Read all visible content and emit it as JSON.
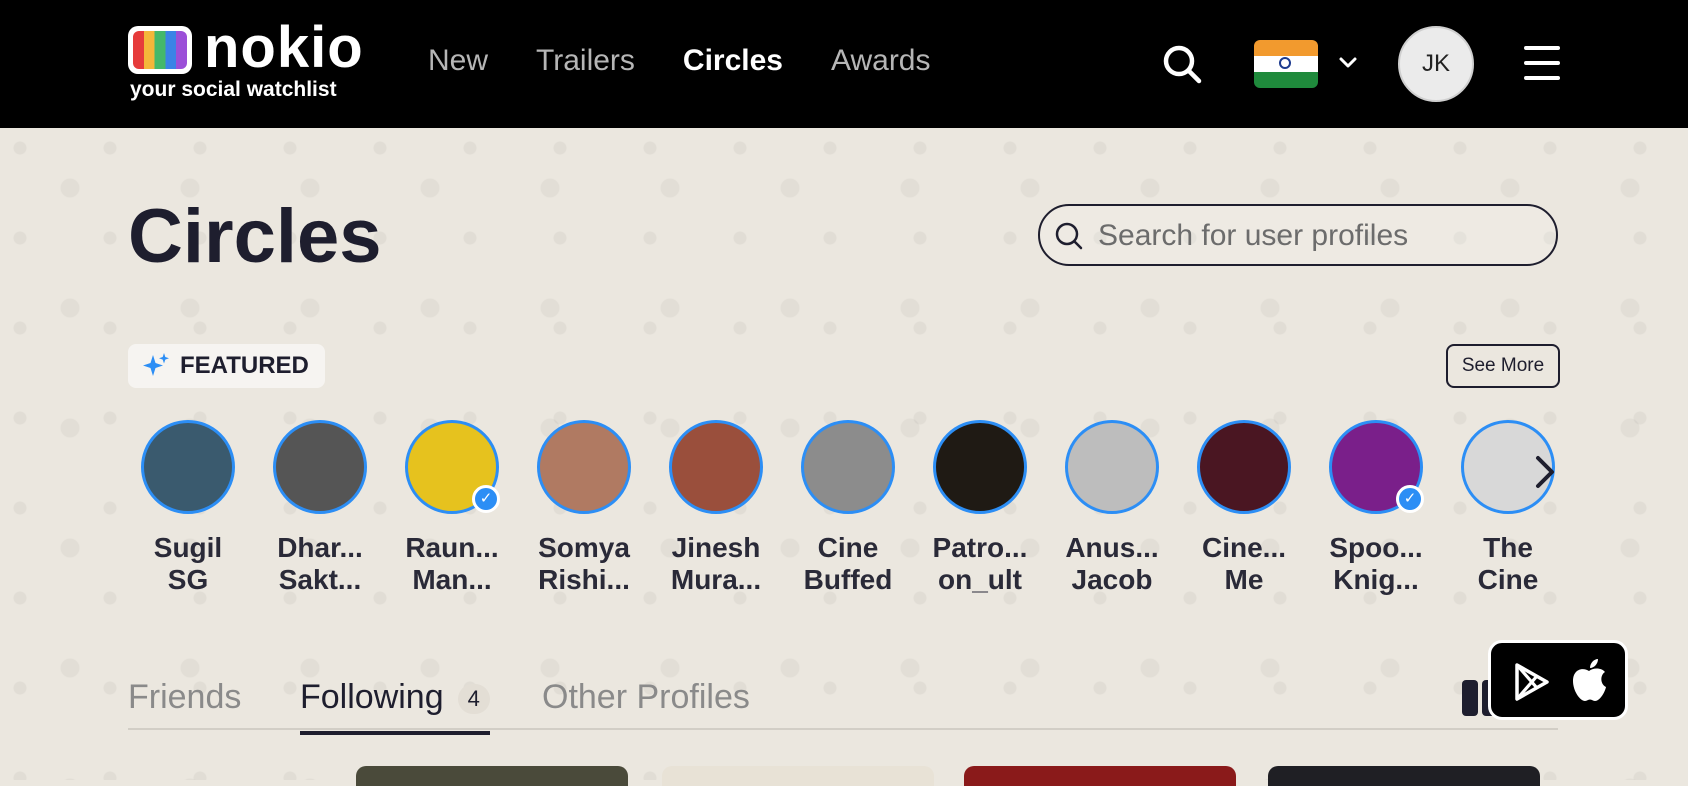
{
  "header": {
    "brand": "nokio",
    "tagline": "your social watchlist",
    "nav": [
      {
        "label": "New",
        "active": false
      },
      {
        "label": "Trailers",
        "active": false
      },
      {
        "label": "Circles",
        "active": true
      },
      {
        "label": "Awards",
        "active": false
      }
    ],
    "user_initials": "JK",
    "region_flag": "india-flag-icon"
  },
  "main": {
    "title": "Circles",
    "search": {
      "placeholder": "Search for user profiles",
      "value": ""
    },
    "featured": {
      "label": "FEATURED",
      "see_more": "See More",
      "profiles": [
        {
          "line1": "Sugil",
          "line2": "SG",
          "verified": false,
          "color": "#3a5a6e"
        },
        {
          "line1": "Dhar...",
          "line2": "Sakt...",
          "verified": false,
          "color": "#555555"
        },
        {
          "line1": "Raun...",
          "line2": "Man...",
          "verified": true,
          "color": "#e6c21e"
        },
        {
          "line1": "Somya",
          "line2": "Rishi...",
          "verified": false,
          "color": "#b07a62"
        },
        {
          "line1": "Jinesh",
          "line2": "Mura...",
          "verified": false,
          "color": "#9a4f3c"
        },
        {
          "line1": "Cine",
          "line2": "Buffed",
          "verified": false,
          "color": "#8c8c8c"
        },
        {
          "line1": "Patro...",
          "line2": "on_ult",
          "verified": false,
          "color": "#1f1a14"
        },
        {
          "line1": "Anus...",
          "line2": "Jacob",
          "verified": false,
          "color": "#bdbdbd"
        },
        {
          "line1": "Cine...",
          "line2": "Me",
          "verified": false,
          "color": "#4a1622"
        },
        {
          "line1": "Spoo...",
          "line2": "Knig...",
          "verified": true,
          "color": "#7a1f8a"
        },
        {
          "line1": "The",
          "line2": "Cine",
          "verified": false,
          "color": "#d8d8d8"
        }
      ]
    },
    "tabs": [
      {
        "label": "Friends",
        "active": false,
        "count": ""
      },
      {
        "label": "Following",
        "active": true,
        "count": "4"
      },
      {
        "label": "Other Profiles",
        "active": false,
        "count": ""
      }
    ]
  },
  "app_badge": {
    "icons": [
      "google-play-icon",
      "apple-icon"
    ]
  },
  "colors": {
    "accent": "#2c8ef5",
    "dark": "#1e1e2e",
    "background": "#ebe7df"
  }
}
